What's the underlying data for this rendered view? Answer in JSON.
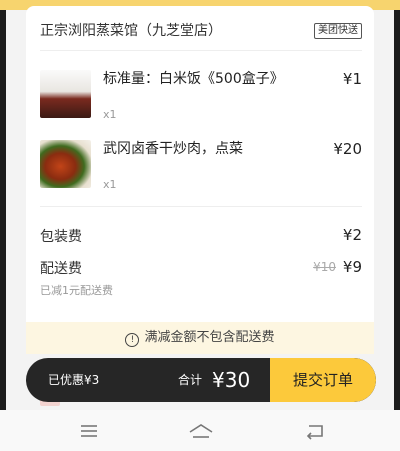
{
  "shop": {
    "name": "正宗浏阳蒸菜馆（九芝堂店）",
    "delivery_badge": "美团快送"
  },
  "items": [
    {
      "title": "标准量：白米饭《500盒子》",
      "qty": "x1",
      "price": "¥1",
      "thumb": "rice-image"
    },
    {
      "title": "武冈卤香干炒肉，点菜",
      "qty": "x1",
      "price": "¥20",
      "thumb": "stirfry-image"
    }
  ],
  "fees": {
    "packing_label": "包装费",
    "packing_value": "¥2",
    "delivery_label": "配送费",
    "delivery_old": "¥10",
    "delivery_value": "¥9",
    "delivery_note": "已减1元配送费"
  },
  "notice": {
    "icon": "info-icon",
    "text": "满减金额不包含配送费"
  },
  "checkout": {
    "saved": "已优惠¥3",
    "total_label": "合计",
    "total_value": "¥30",
    "submit_label": "提交订单"
  },
  "colors": {
    "accent": "#fcc93b",
    "bar": "#262626"
  }
}
